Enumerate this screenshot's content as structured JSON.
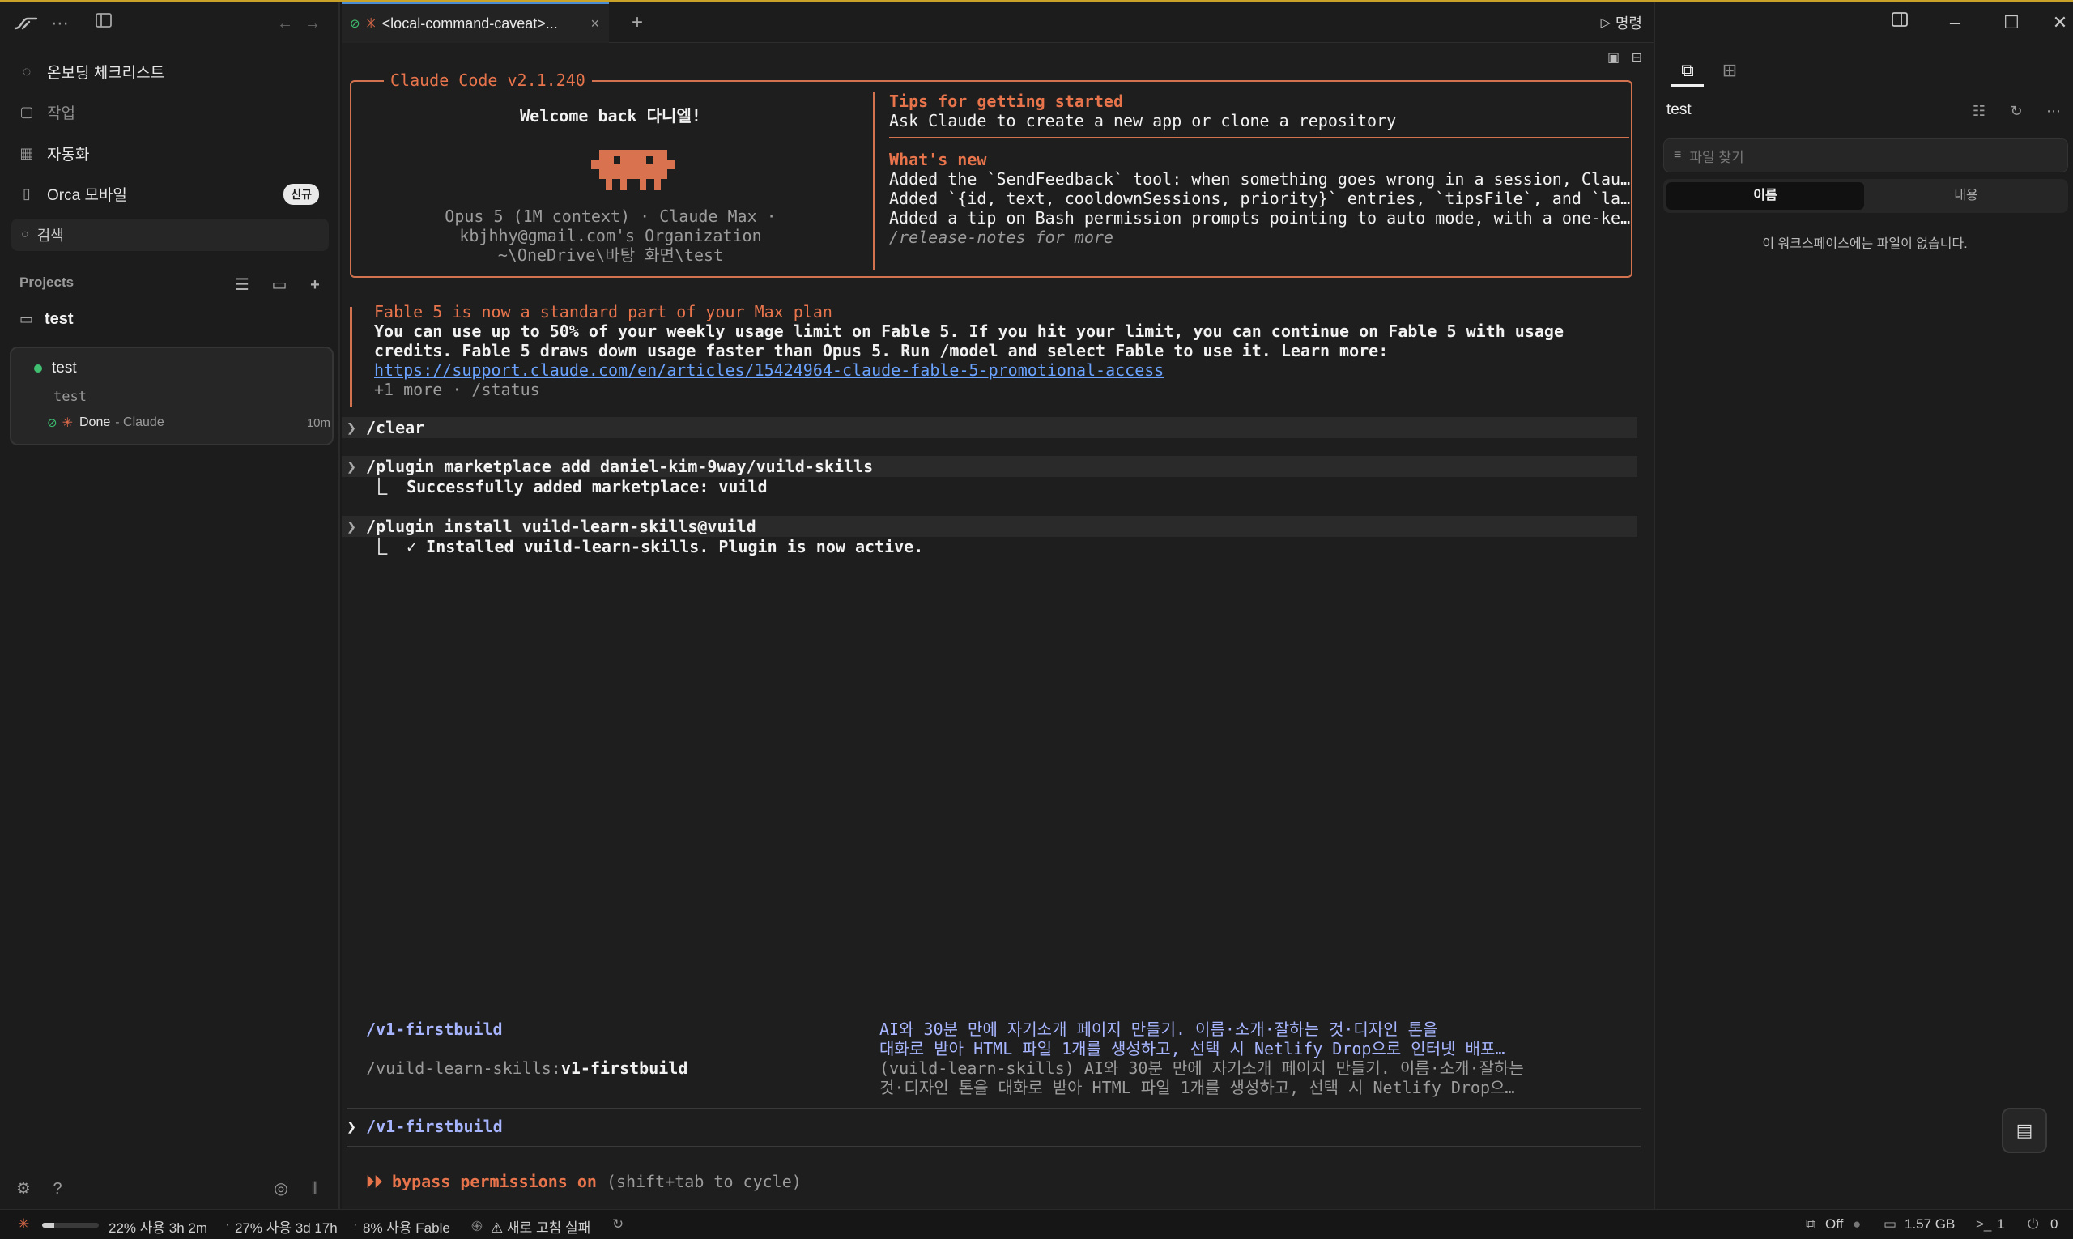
{
  "sidebar": {
    "nav": [
      {
        "label": "온보딩 체크리스트",
        "icon": "progress-circle-icon"
      },
      {
        "label": "작업",
        "icon": "draft-icon"
      },
      {
        "label": "자동화",
        "icon": "calendar-icon"
      },
      {
        "label": "Orca 모바일",
        "icon": "phone-icon",
        "badge": "신규"
      }
    ],
    "search_label": "검색",
    "projects_label": "Projects",
    "project_name": "test",
    "workspace": {
      "name": "test",
      "subtitle": "test",
      "status": "Done",
      "agent": "- Claude",
      "age": "10m"
    }
  },
  "tab": {
    "title": "<local-command-caveat>...",
    "run_label": "명령"
  },
  "terminal": {
    "box_title": "Claude Code v2.1.240",
    "welcome": "Welcome back 다니엘!",
    "model_line": "Opus 5 (1M context) · Claude Max ·",
    "org_line": "kbjhhy@gmail.com's Organization",
    "path_line": "~\\OneDrive\\바탕 화면\\test",
    "tips_title": "Tips for getting started",
    "tips_text": "Ask Claude to create a new app or clone a repository",
    "whats_new_title": "What's new",
    "whats_new": [
      "Added the `SendFeedback` tool: when something goes wrong in a session, Clau…",
      "Added `{id, text, cooldownSessions, priority}` entries, `tipsFile`, and `la…",
      "Added a tip on Bash permission prompts pointing to auto mode, with a one-ke…"
    ],
    "release_notes": "/release-notes for more",
    "fable_title": "Fable 5 is now a standard part of your Max plan",
    "fable_line1": "You can use up to 50% of your weekly usage limit on Fable 5. If you hit your limit, you can continue on Fable 5 with usage",
    "fable_line2": "credits. Fable 5 draws down usage faster than Opus 5. Run /model and select Fable to use it. Learn more:",
    "fable_link": "https://support.claude.com/en/articles/15424964-claude-fable-5-promotional-access",
    "fable_more": "+1 more · /status",
    "cmd1": "/clear",
    "cmd2": "/plugin marketplace add daniel-kim-9way/vuild-skills",
    "cmd2_result": "⎿  Successfully added marketplace: vuild",
    "cmd3": "/plugin install vuild-learn-skills@vuild",
    "cmd3_result": "⎿  ✓ Installed vuild-learn-skills. Plugin is now active.",
    "suggest1_cmd": "/v1-firstbuild",
    "suggest1_desc_a": "AI와 30분 만에 자기소개 페이지 만들기. 이름·소개·잘하는 것·디자인 톤을",
    "suggest1_desc_b": "대화로 받아 HTML 파일 1개를 생성하고, 선택 시 Netlify Drop으로 인터넷 배포…",
    "suggest2_prefix": "/vuild-learn-skills:",
    "suggest2_cmd": "v1-firstbuild",
    "suggest2_desc_a": "(vuild-learn-skills) AI와 30분 만에 자기소개 페이지 만들기. 이름·소개·잘하는",
    "suggest2_desc_b": "것·디자인 톤을 대화로 받아 HTML 파일 1개를 생성하고, 선택 시 Netlify Drop으…",
    "input_value": "/v1-firstbuild",
    "bypass_label": "bypass permissions on",
    "bypass_hint": "(shift+tab to cycle)"
  },
  "right_panel": {
    "title": "test",
    "file_search_placeholder": "파일 찾기",
    "seg_name": "이름",
    "seg_content": "내용",
    "empty_message": "이 워크스페이스에는 파일이 없습니다."
  },
  "statusbar": {
    "usage_fraction": 0.22,
    "usage1": "22% 사용 3h 2m",
    "usage2": "27% 사용 3d 17h",
    "usage3": "8% 사용 Fable",
    "refresh_fail": "⚠ 새로 고침 실패",
    "off_label": "Off",
    "memory": "1.57 GB",
    "terminals": "1",
    "ports": "0"
  },
  "colors": {
    "accent_orange": "#e8744c",
    "link_blue": "#6aa2ff",
    "success_green": "#3fbf6f"
  }
}
